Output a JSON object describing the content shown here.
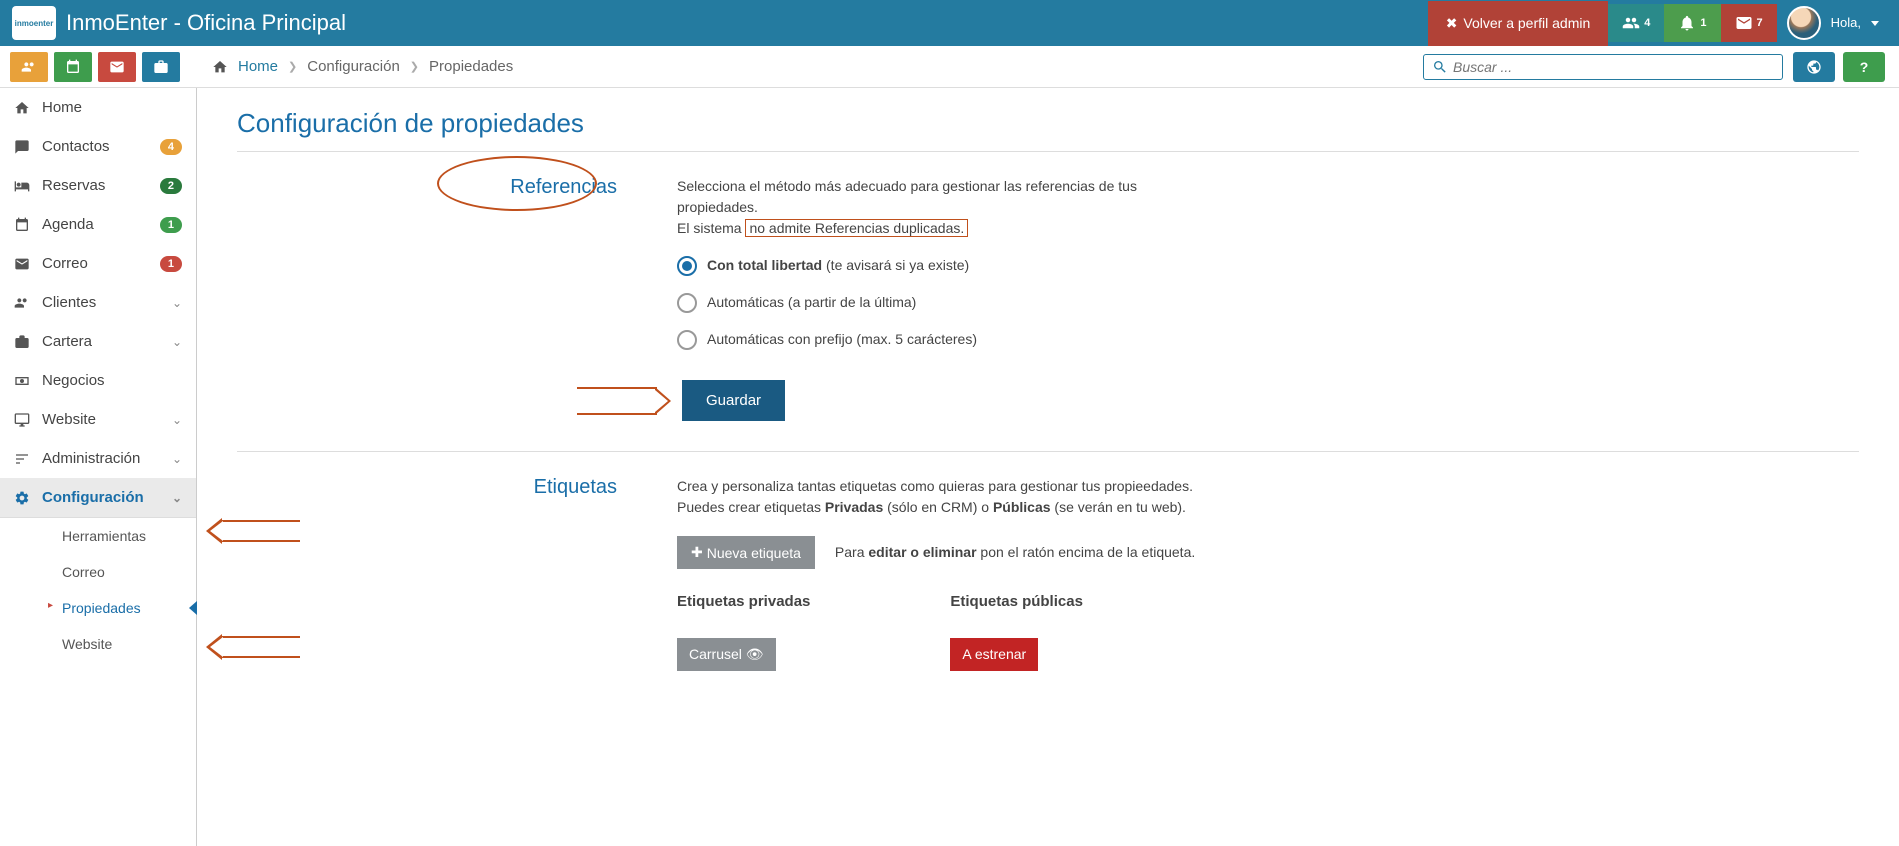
{
  "header": {
    "logo_text": "inmoenter",
    "title": "InmoEnter - Oficina Principal",
    "back_admin": "Volver a perfil admin",
    "user_greeting": "Hola,",
    "badges": {
      "users": "4",
      "bell": "1",
      "mail": "7"
    }
  },
  "search": {
    "placeholder": "Buscar ..."
  },
  "breadcrumb": {
    "home": "Home",
    "config": "Configuración",
    "props": "Propiedades"
  },
  "sidebar": {
    "home": "Home",
    "contactos": "Contactos",
    "contactos_badge": "4",
    "reservas": "Reservas",
    "reservas_badge": "2",
    "agenda": "Agenda",
    "agenda_badge": "1",
    "correo": "Correo",
    "correo_badge": "1",
    "clientes": "Clientes",
    "cartera": "Cartera",
    "negocios": "Negocios",
    "website": "Website",
    "admin": "Administración",
    "config": "Configuración",
    "sub_herr": "Herramientas",
    "sub_correo": "Correo",
    "sub_prop": "Propiedades",
    "sub_web": "Website"
  },
  "main": {
    "page_title": "Configuración de propiedades",
    "referencias": {
      "heading": "Referencias",
      "desc1": "Selecciona el método más adecuado para gestionar las referencias de tus propiedades.",
      "desc2_a": "El sistema ",
      "desc2_b": "no admite Referencias duplicadas.",
      "opt1_strong": "Con total libertad",
      "opt1_rest": " (te avisará si ya existe)",
      "opt2": "Automáticas (a partir de la última)",
      "opt3": "Automáticas con prefijo (max. 5 carácteres)",
      "save": "Guardar"
    },
    "etiquetas": {
      "heading": "Etiquetas",
      "desc1": "Crea y personaliza tantas etiquetas como quieras para gestionar tus propieedades.",
      "desc2_a": "Puedes crear etiquetas ",
      "desc2_b": "Privadas",
      "desc2_c": " (sólo en CRM) o ",
      "desc2_d": "Públicas",
      "desc2_e": " (se verán en tu web).",
      "new_tag": "Nueva etiqueta",
      "edit_hint_a": "Para ",
      "edit_hint_b": "editar o eliminar",
      "edit_hint_c": " pon el ratón encima de la etiqueta.",
      "priv_heading": "Etiquetas privadas",
      "pub_heading": "Etiquetas públicas",
      "tag_carrusel": "Carrusel",
      "tag_estrenar": "A estrenar"
    }
  },
  "help_q": "?"
}
